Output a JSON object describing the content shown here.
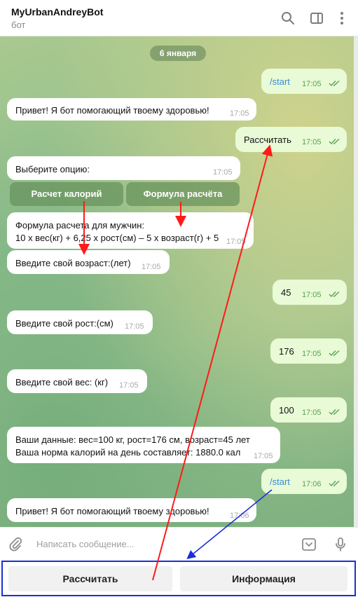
{
  "header": {
    "title": "MyUrbanAndreyBot",
    "subtitle": "бот"
  },
  "chat": {
    "date_label": "6 января",
    "messages": [
      {
        "dir": "out",
        "text": "/start",
        "time": "17:05"
      },
      {
        "dir": "in",
        "text": "Привет! Я бот помогающий твоему здоровью!",
        "time": "17:05"
      },
      {
        "dir": "out",
        "text": "Рассчитать",
        "time": "17:05"
      },
      {
        "dir": "in",
        "text": "Выберите опцию:",
        "time": "17:05"
      },
      {
        "dir": "in",
        "line1": "Формула расчета для мужчин:",
        "line2": "10 х вес(кг) + 6,25 x рост(см) – 5 х возраст(г) + 5",
        "time": "17:05"
      },
      {
        "dir": "in",
        "text": "Введите свой возраст:(лет)",
        "time": "17:05"
      },
      {
        "dir": "out",
        "text": "45",
        "time": "17:05"
      },
      {
        "dir": "in",
        "text": "Введите свой рост:(см)",
        "time": "17:05"
      },
      {
        "dir": "out",
        "text": "176",
        "time": "17:05"
      },
      {
        "dir": "in",
        "text": "Введите свой вес: (кг)",
        "time": "17:05"
      },
      {
        "dir": "out",
        "text": "100",
        "time": "17:05"
      },
      {
        "dir": "in",
        "line1": "Ваши данные: вес=100 кг, рост=176 см, возраст=45 лет",
        "line2": "Ваша норма калорий на день составляет: 1880.0 кал",
        "time": "17:05"
      },
      {
        "dir": "out",
        "text": "/start",
        "time": "17:06"
      },
      {
        "dir": "in",
        "text": "Привет! Я бот помогающий твоему здоровью!",
        "time": "17:06"
      }
    ],
    "inline_buttons": [
      "Расчет калорий",
      "Формула расчёта"
    ]
  },
  "input": {
    "placeholder": "Написать сообщение..."
  },
  "keyboard": {
    "buttons": [
      "Рассчитать",
      "Информация"
    ]
  },
  "colors": {
    "outgoing_bubble": "#e8fad6",
    "annotation_red": "#ff1a1a",
    "annotation_blue": "#1a2fd6"
  },
  "icons": [
    "search-icon",
    "sidebar-toggle-icon",
    "more-vertical-icon",
    "double-check-icon",
    "paperclip-icon",
    "keyboard-toggle-icon",
    "microphone-icon"
  ]
}
